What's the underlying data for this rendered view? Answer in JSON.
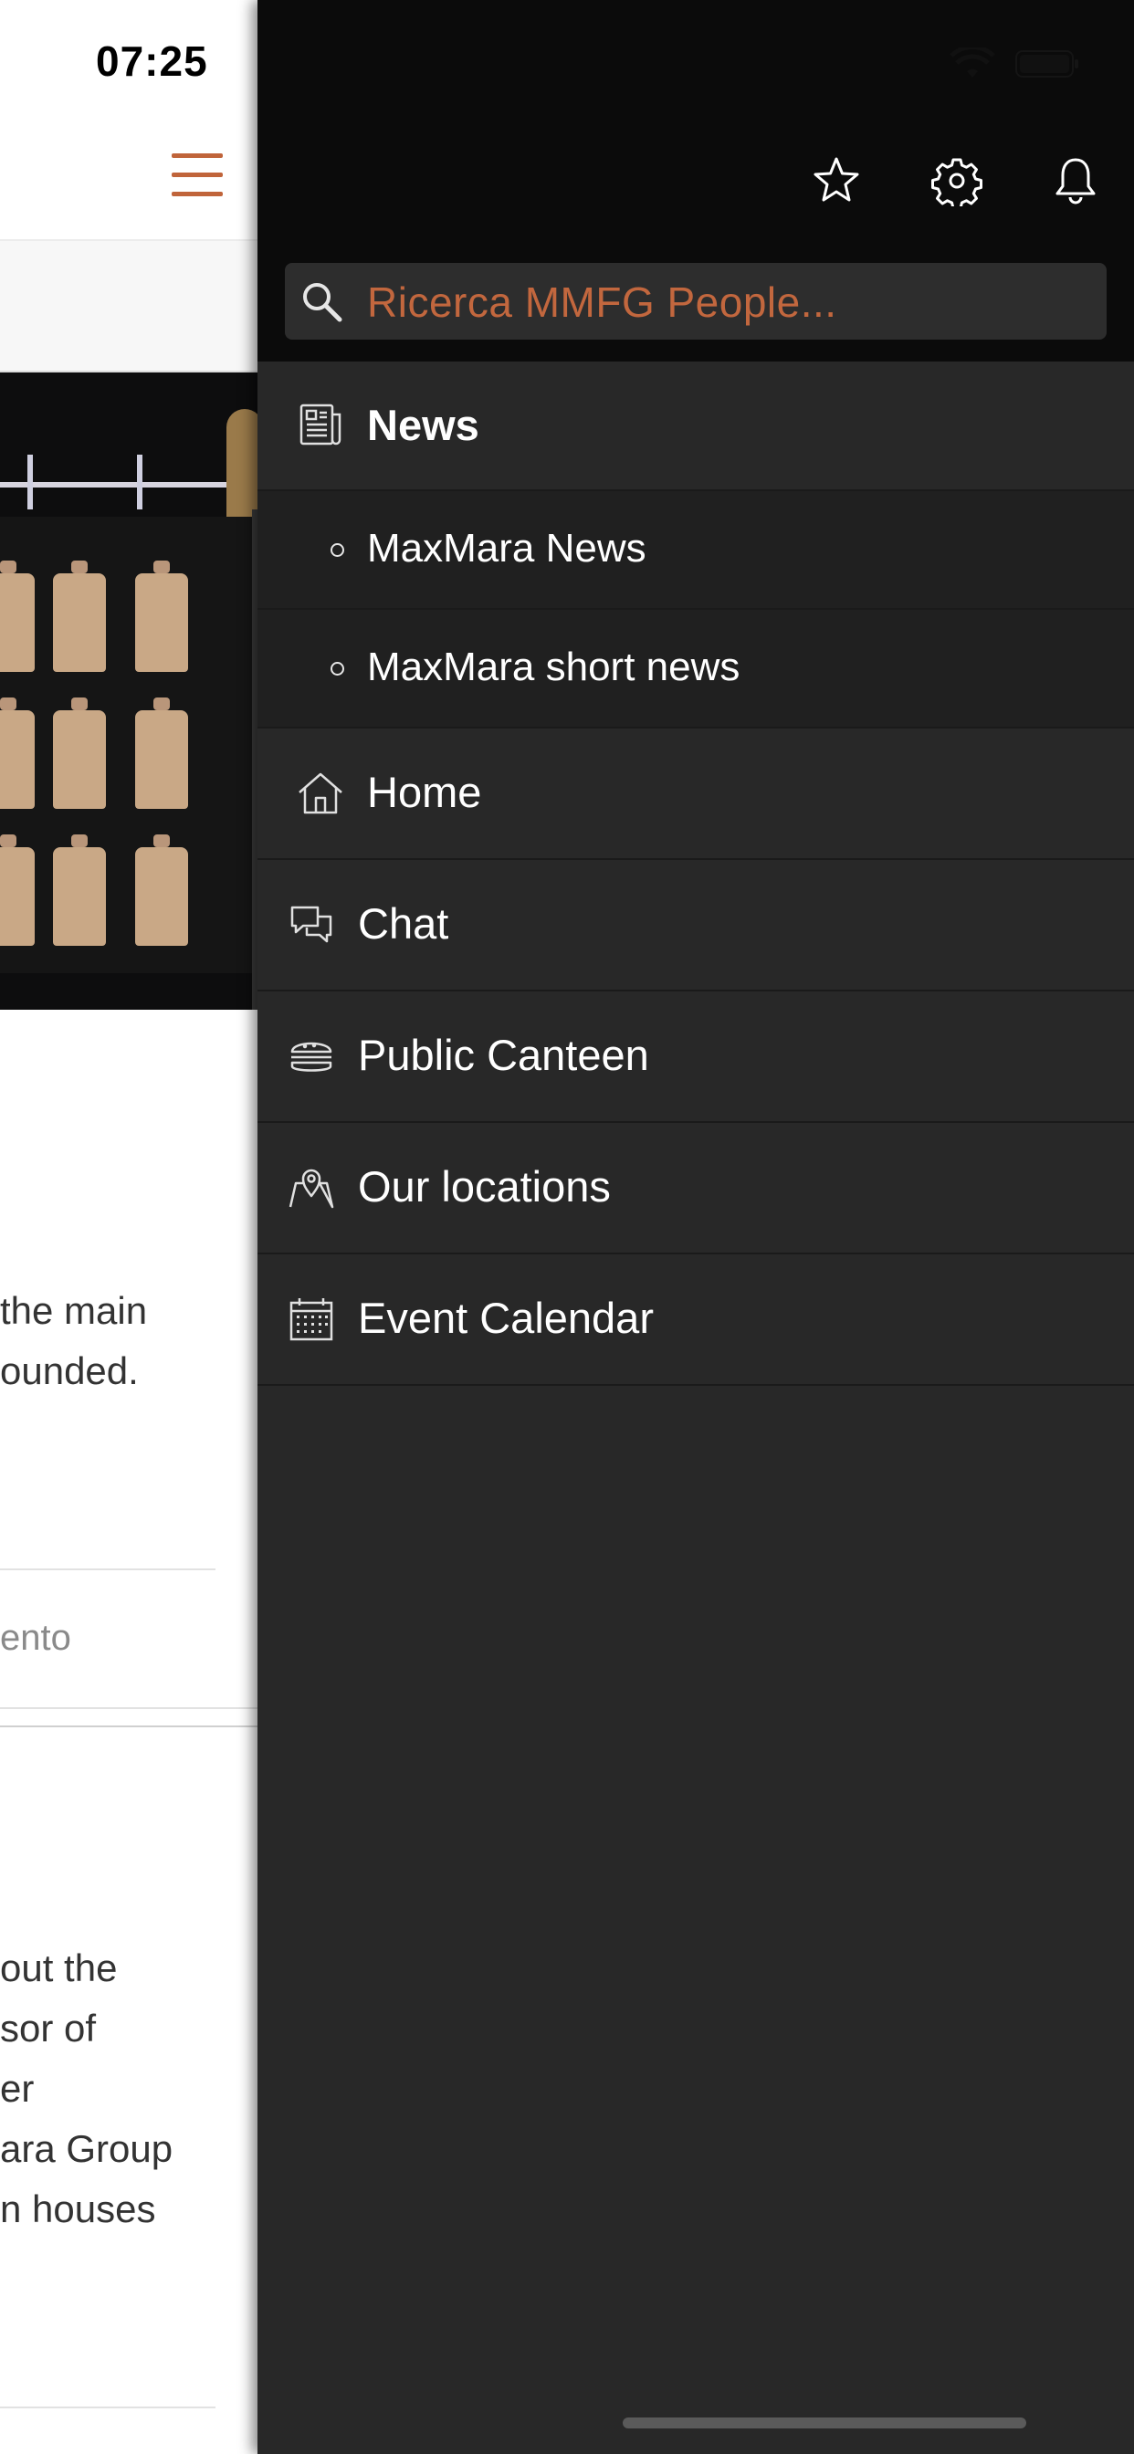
{
  "status_bar": {
    "time": "07:25"
  },
  "background_page": {
    "text_line_1": "the main",
    "text_line_2": "ounded.",
    "bottom_link": "ento",
    "paragraph_lines": [
      "out the",
      "sor of",
      "er",
      "ara Group",
      "n houses"
    ]
  },
  "drawer": {
    "search": {
      "placeholder": "Ricerca MMFG People..."
    },
    "top_icons": [
      "star-icon",
      "gear-icon",
      "bell-icon"
    ],
    "menu": {
      "news": {
        "label": "News",
        "icon": "newspaper-icon"
      },
      "news_sub": [
        {
          "label": "MaxMara News"
        },
        {
          "label": "MaxMara short news"
        }
      ],
      "home": {
        "label": "Home",
        "icon": "home-icon"
      },
      "chat": {
        "label": "Chat",
        "icon": "chat-icon"
      },
      "canteen": {
        "label": "Public Canteen",
        "icon": "burger-icon"
      },
      "locations": {
        "label": "Our locations",
        "icon": "map-pin-icon"
      },
      "calendar": {
        "label": "Event Calendar",
        "icon": "calendar-icon"
      }
    }
  },
  "colors": {
    "accent": "#c2673e",
    "drawer_bg": "#282828",
    "drawer_top_bg": "#0b0b0b"
  }
}
